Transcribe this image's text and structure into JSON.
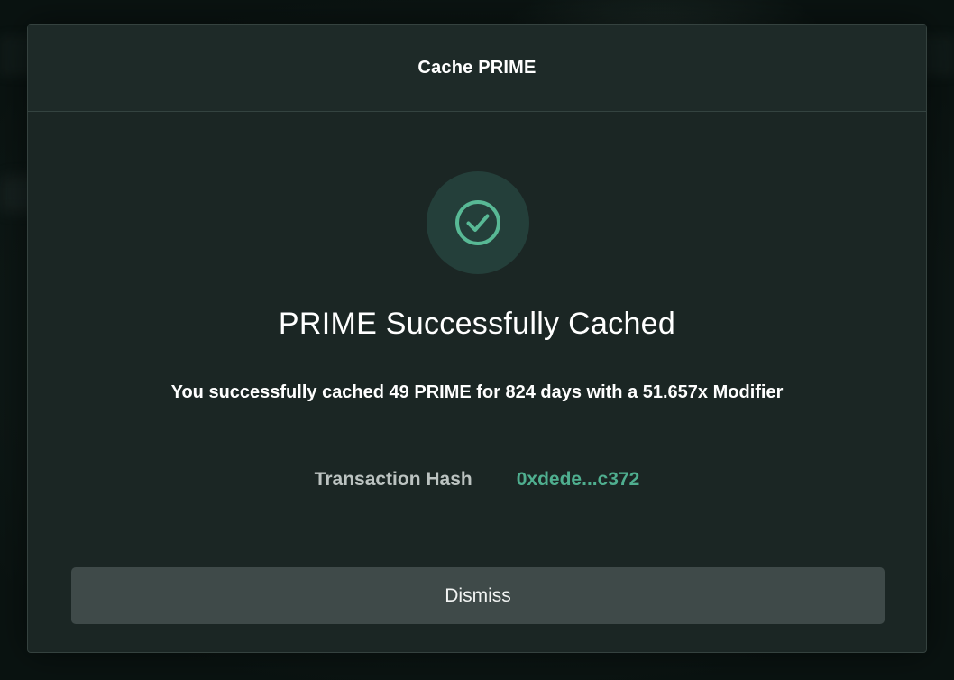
{
  "modal": {
    "title": "Cache PRIME",
    "status_icon": "check-circle-icon",
    "heading": "PRIME Successfully Cached",
    "message": "You successfully cached 49 PRIME for 824 days with a 51.657x Modifier",
    "transaction": {
      "label": "Transaction Hash",
      "hash": "0xdede...c372"
    },
    "dismiss_label": "Dismiss"
  },
  "colors": {
    "accent": "#4fae8f",
    "modal_background": "#1b2624",
    "button_background": "#3f4a49",
    "success_circle": "#243f3a"
  }
}
